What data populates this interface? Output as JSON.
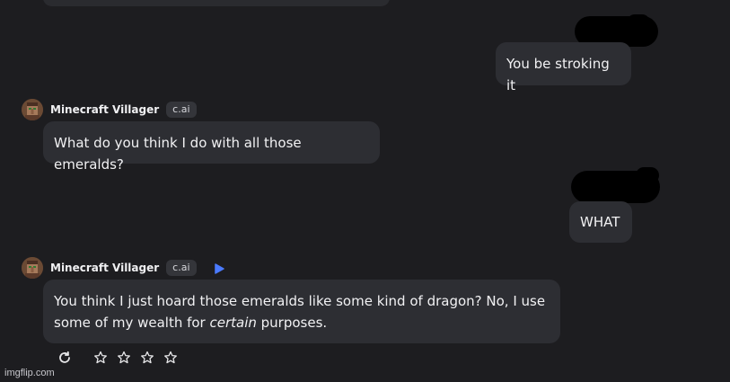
{
  "messages": {
    "user_1": "You be stroking it",
    "bot_1": {
      "name": "Minecraft Villager",
      "badge": "c.ai",
      "text": "What do you think I do with all those emeralds?"
    },
    "user_2": "WHAT",
    "bot_2": {
      "name": "Minecraft Villager",
      "badge": "c.ai",
      "text_before": "You think I just hoard those emeralds like some kind of dragon? No, I use some of my wealth for ",
      "text_italic": "certain",
      "text_after": " purposes."
    }
  },
  "rating": {
    "stars": 4,
    "selected": 0
  },
  "watermark": "imgflip.com",
  "colors": {
    "background": "#1d1d20",
    "bubble": "#2d2e33",
    "text": "#f1f1f3",
    "accent_play": "#4b7bff",
    "redaction": "#000000"
  },
  "icons": {
    "regenerate": "refresh-icon",
    "star": "star-icon",
    "play": "play-icon",
    "avatar": "villager-avatar-icon"
  }
}
